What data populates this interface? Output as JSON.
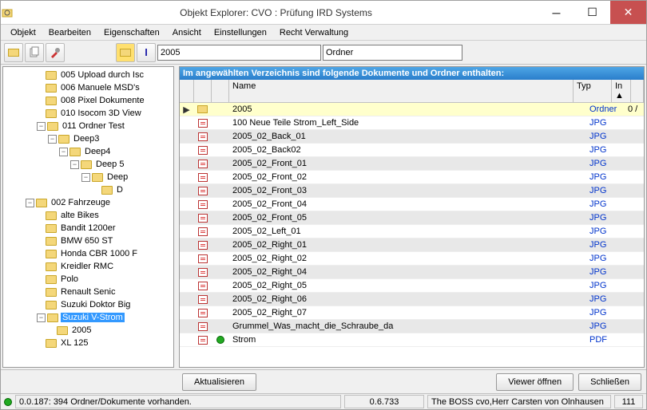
{
  "window": {
    "title": "Objekt Explorer: CVO : Prüfung IRD Systems"
  },
  "menu": {
    "items": [
      "Objekt",
      "Bearbeiten",
      "Eigenschaften",
      "Ansicht",
      "Einstellungen",
      "Recht Verwaltung"
    ]
  },
  "toolbar": {
    "path_value": "2005",
    "type_value": "Ordner"
  },
  "tree": {
    "items": [
      {
        "indent": 3,
        "exp": null,
        "label": "005 Upload durch Isc"
      },
      {
        "indent": 3,
        "exp": null,
        "label": "006 Manuele MSD's"
      },
      {
        "indent": 3,
        "exp": null,
        "label": "008 Pixel Dokumente"
      },
      {
        "indent": 3,
        "exp": null,
        "label": "010 Isocom 3D View"
      },
      {
        "indent": 3,
        "exp": "-",
        "label": "011 Ordner Test"
      },
      {
        "indent": 4,
        "exp": "-",
        "label": "Deep3"
      },
      {
        "indent": 5,
        "exp": "-",
        "label": "Deep4"
      },
      {
        "indent": 6,
        "exp": "-",
        "label": "Deep 5"
      },
      {
        "indent": 7,
        "exp": "-",
        "label": "Deep"
      },
      {
        "indent": 8,
        "exp": null,
        "label": "D"
      },
      {
        "indent": 2,
        "exp": "-",
        "label": "002 Fahrzeuge"
      },
      {
        "indent": 3,
        "exp": null,
        "label": "alte Bikes"
      },
      {
        "indent": 3,
        "exp": null,
        "label": "Bandit 1200er"
      },
      {
        "indent": 3,
        "exp": null,
        "label": "BMW 650 ST"
      },
      {
        "indent": 3,
        "exp": null,
        "label": "Honda CBR 1000 F"
      },
      {
        "indent": 3,
        "exp": null,
        "label": "Kreidler RMC"
      },
      {
        "indent": 3,
        "exp": null,
        "label": "Polo"
      },
      {
        "indent": 3,
        "exp": null,
        "label": "Renault Senic"
      },
      {
        "indent": 3,
        "exp": null,
        "label": "Suzuki Doktor Big"
      },
      {
        "indent": 3,
        "exp": "-",
        "label": "Suzuki V-Strom",
        "selected": true
      },
      {
        "indent": 4,
        "exp": null,
        "label": "2005"
      },
      {
        "indent": 3,
        "exp": null,
        "label": "XL 125"
      }
    ]
  },
  "list": {
    "header_msg": "Im angewählten Verzeichnis sind folgende Dokumente und Ordner enthalten:",
    "columns": {
      "name": "Name",
      "typ": "Typ",
      "in": "In"
    },
    "rows": [
      {
        "pointer": "▶",
        "icon": "folder",
        "name": "2005",
        "typ": "Ordner",
        "in": "0 /",
        "hl": true
      },
      {
        "icon": "file",
        "name": "100 Neue Teile Strom_Left_Side",
        "typ": "JPG"
      },
      {
        "icon": "file",
        "name": "2005_02_Back_01",
        "typ": "JPG"
      },
      {
        "icon": "file",
        "name": "2005_02_Back02",
        "typ": "JPG"
      },
      {
        "icon": "file",
        "name": "2005_02_Front_01",
        "typ": "JPG"
      },
      {
        "icon": "file",
        "name": "2005_02_Front_02",
        "typ": "JPG"
      },
      {
        "icon": "file",
        "name": "2005_02_Front_03",
        "typ": "JPG"
      },
      {
        "icon": "file",
        "name": "2005_02_Front_04",
        "typ": "JPG"
      },
      {
        "icon": "file",
        "name": "2005_02_Front_05",
        "typ": "JPG"
      },
      {
        "icon": "file",
        "name": "2005_02_Left_01",
        "typ": "JPG"
      },
      {
        "icon": "file",
        "name": "2005_02_Right_01",
        "typ": "JPG"
      },
      {
        "icon": "file",
        "name": "2005_02_Right_02",
        "typ": "JPG"
      },
      {
        "icon": "file",
        "name": "2005_02_Right_04",
        "typ": "JPG"
      },
      {
        "icon": "file",
        "name": "2005_02_Right_05",
        "typ": "JPG"
      },
      {
        "icon": "file",
        "name": "2005_02_Right_06",
        "typ": "JPG"
      },
      {
        "icon": "file",
        "name": "2005_02_Right_07",
        "typ": "JPG"
      },
      {
        "icon": "file",
        "name": "Grummel_Was_macht_die_Schraube_da",
        "typ": "JPG"
      },
      {
        "icon": "file",
        "green": true,
        "name": "Strom",
        "typ": "PDF"
      }
    ]
  },
  "buttons": {
    "aktualisieren": "Aktualisieren",
    "viewer": "Viewer öffnen",
    "schliessen": "Schließen"
  },
  "status": {
    "left": "0.0.187: 394 Ordner/Dokumente vorhanden.",
    "mid": "0.6.733",
    "right": "The BOSS cvo,Herr Carsten von Olnhausen",
    "num": "111"
  }
}
